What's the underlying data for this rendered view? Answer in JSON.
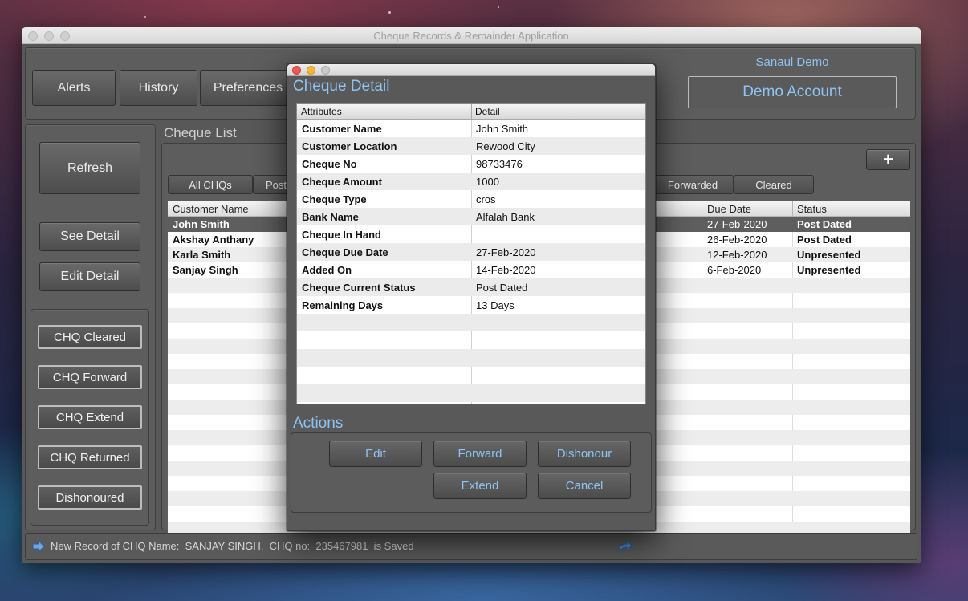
{
  "window": {
    "title": "Cheque Records & Remainder Application"
  },
  "top_nav": {
    "alerts": "Alerts",
    "history": "History",
    "preferences": "Preferences"
  },
  "account": {
    "user_name": "Sanaul Demo",
    "account_name": "Demo Account"
  },
  "sidebar": {
    "refresh": "Refresh",
    "see_detail": "See Detail",
    "edit_detail": "Edit Detail",
    "status_buttons": [
      "CHQ Cleared",
      "CHQ Forward",
      "CHQ Extend",
      "CHQ Returned",
      "Dishonoured"
    ]
  },
  "cheque_list": {
    "title": "Cheque List",
    "tabs": {
      "all": "All CHQs",
      "post": "Post",
      "forwarded": "Forwarded",
      "cleared": "Cleared"
    },
    "add_icon": "plus-icon",
    "columns": {
      "customer": "Customer Name",
      "due_date": "Due Date",
      "status": "Status"
    },
    "rows": [
      {
        "customer": "John Smith",
        "due_date": "27-Feb-2020",
        "status": "Post Dated"
      },
      {
        "customer": "Akshay Anthany",
        "due_date": "26-Feb-2020",
        "status": "Post Dated"
      },
      {
        "customer": "Karla Smith",
        "due_date": "12-Feb-2020",
        "status": "Unpresented"
      },
      {
        "customer": "Sanjay Singh",
        "due_date": "6-Feb-2020",
        "status": "Unpresented"
      }
    ]
  },
  "status_bar": {
    "message": "New Record of CHQ Name:  SANJAY SINGH,  CHQ no:  235467981  is Saved",
    "left_icon": "arrow-right-icon",
    "right_icon": "share-arrow-icon"
  },
  "dialog": {
    "title": "Cheque Detail",
    "columns": {
      "attr": "Attributes",
      "detail": "Detail"
    },
    "rows": [
      {
        "k": "Customer Name",
        "v": "John Smith"
      },
      {
        "k": "Customer Location",
        "v": "Rewood City"
      },
      {
        "k": "Cheque No",
        "v": "98733476"
      },
      {
        "k": "Cheque Amount",
        "v": "1000"
      },
      {
        "k": "Cheque Type",
        "v": "cros"
      },
      {
        "k": "Bank Name",
        "v": "Alfalah Bank"
      },
      {
        "k": "Cheque In Hand",
        "v": ""
      },
      {
        "k": "Cheque Due Date",
        "v": "27-Feb-2020"
      },
      {
        "k": "Added On",
        "v": "14-Feb-2020"
      },
      {
        "k": "Cheque Current Status",
        "v": "Post Dated"
      },
      {
        "k": "Remaining Days",
        "v": "13 Days"
      }
    ],
    "actions_title": "Actions",
    "actions": {
      "edit": "Edit",
      "forward": "Forward",
      "dishonour": "Dishonour",
      "extend": "Extend",
      "cancel": "Cancel"
    }
  },
  "colors": {
    "accent_blue": "#8fc3f3",
    "window_gray": "#585858",
    "selected_row": "#5e5e5e"
  }
}
